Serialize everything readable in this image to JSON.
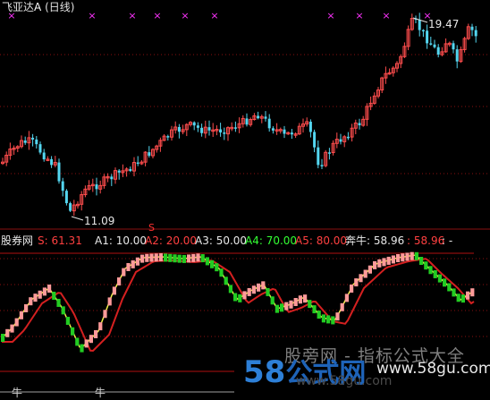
{
  "title": {
    "stock": "飞亚达",
    "suffix": "A",
    "period": "(日线)"
  },
  "annotations": {
    "high_label": "19.47",
    "low_label": "11.09",
    "s_marker": "S"
  },
  "indicator": {
    "name": "股券网",
    "s": "S: 61.31",
    "a1": "A1: 10.00",
    "a2": "A2: 20.00",
    "a3": "A3: 50.00",
    "a4": "A4: 70.00",
    "a5": "A5: 80.00",
    "benniu": "奔牛: 58.96",
    "extra": ": 58.96",
    "dash": ": -"
  },
  "niu_labels": [
    "牛",
    "牛"
  ],
  "watermark": {
    "cn": "股旁网 - 指标公式大全",
    "logo_num": "58",
    "logo_cn": "公式网",
    "url": "www.58gu.com",
    "url_faded": "www.58gu.com"
  },
  "colors": {
    "up": "#ff4d4d",
    "down": "#54d6f0",
    "ma_red": "#d42020",
    "ma_yellow": "#f2f24a",
    "bar_up": "#ff9a9a",
    "bar_down": "#22cc22",
    "marker": "#ff33ff",
    "hline": "#b01010"
  },
  "icons": {
    "top_marker": "x-mark-icon"
  }
}
